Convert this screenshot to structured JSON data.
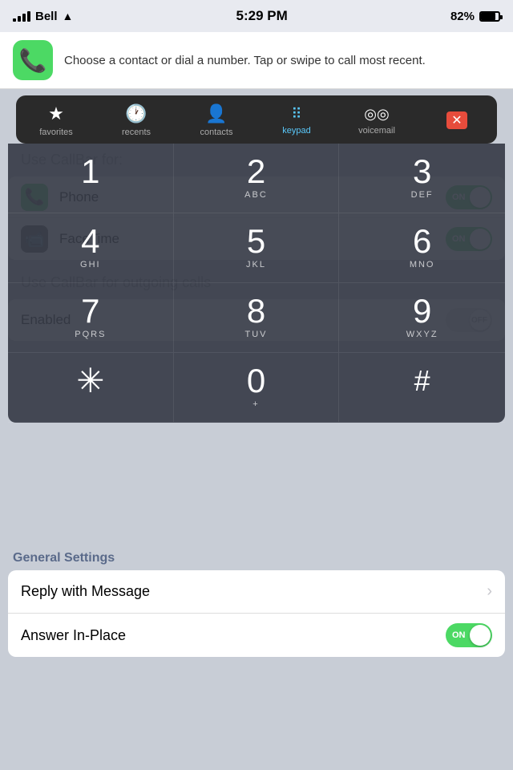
{
  "statusBar": {
    "carrier": "Bell",
    "time": "5:29 PM",
    "battery": "82%"
  },
  "notification": {
    "appName": "Phone",
    "message": "Choose a contact or dial a number. Tap or swipe to call most recent."
  },
  "tabs": [
    {
      "id": "favorites",
      "label": "favorites",
      "icon": "★",
      "active": false
    },
    {
      "id": "recents",
      "label": "recents",
      "icon": "🕐",
      "active": false
    },
    {
      "id": "contacts",
      "label": "contacts",
      "icon": "👤",
      "active": false
    },
    {
      "id": "keypad",
      "label": "keypad",
      "icon": "⠿",
      "active": true
    },
    {
      "id": "voicemail",
      "label": "voicemail",
      "icon": "◎◎",
      "active": false
    },
    {
      "id": "close",
      "label": "",
      "icon": "✕",
      "active": false
    }
  ],
  "keypad": {
    "keys": [
      {
        "number": "1",
        "letters": ""
      },
      {
        "number": "2",
        "letters": "ABC"
      },
      {
        "number": "3",
        "letters": "DEF"
      },
      {
        "number": "4",
        "letters": "GHI"
      },
      {
        "number": "5",
        "letters": "JKL"
      },
      {
        "number": "6",
        "letters": "MNO"
      },
      {
        "number": "7",
        "letters": "PQRS"
      },
      {
        "number": "8",
        "letters": "TUV"
      },
      {
        "number": "9",
        "letters": "WXYZ"
      },
      {
        "number": "*",
        "letters": ""
      },
      {
        "number": "0",
        "letters": "+"
      },
      {
        "number": "#",
        "letters": ""
      }
    ]
  },
  "callbarSettings": {
    "title": "Use CallBar for:",
    "items": [
      {
        "label": "Phone",
        "iconBg": "#4cd964",
        "iconEmoji": "📞",
        "enabled": true
      },
      {
        "label": "FaceTime",
        "iconBg": "#555",
        "iconEmoji": "📹",
        "enabled": true
      }
    ],
    "outgoingLabel": "Use CallBar for outgoing calls",
    "enabledLabel": "Enabled"
  },
  "generalSettings": {
    "header": "General Settings",
    "items": [
      {
        "label": "Reply with Message",
        "type": "chevron"
      },
      {
        "label": "Answer In-Place",
        "type": "toggle",
        "value": true
      }
    ]
  },
  "toggleLabels": {
    "on": "ON",
    "off": "OFF"
  }
}
